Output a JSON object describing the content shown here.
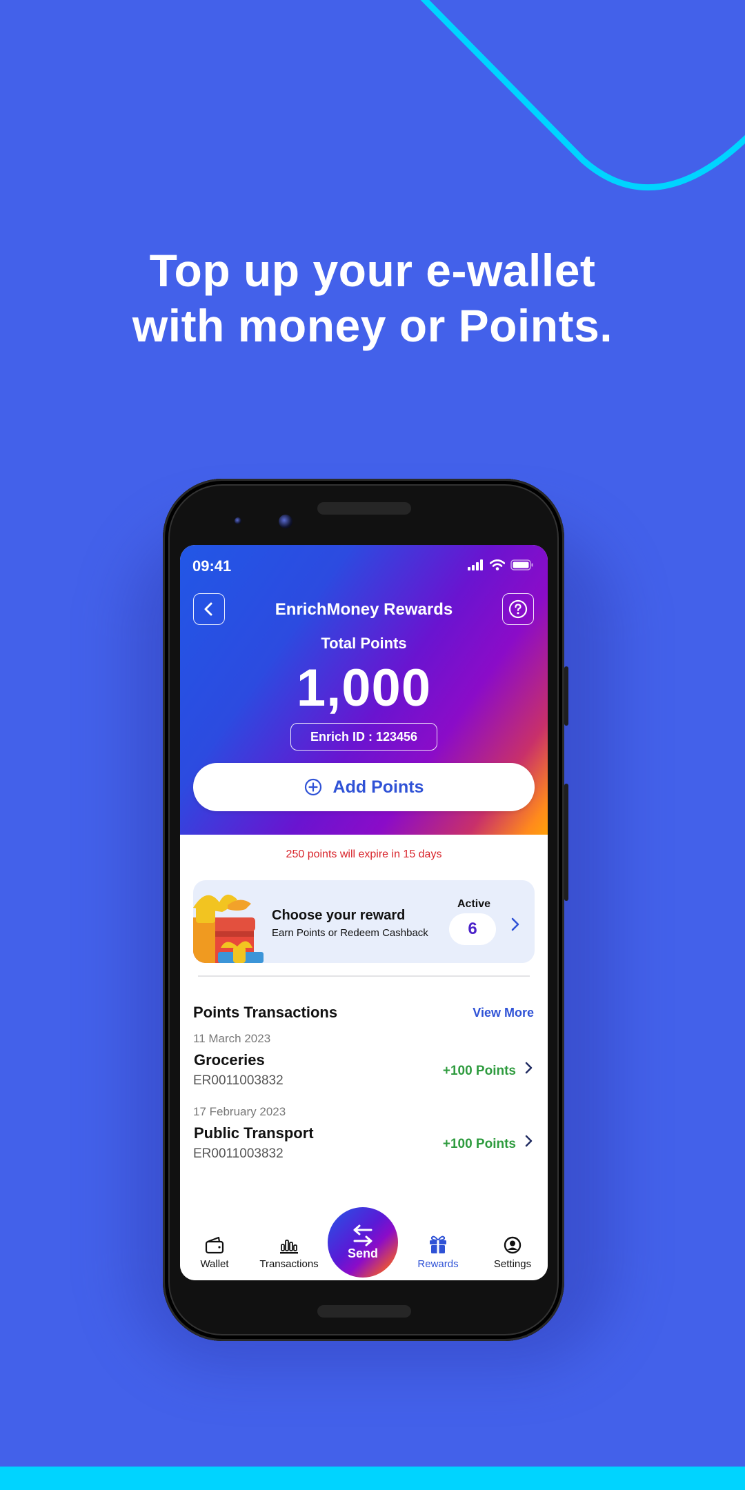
{
  "promo": {
    "headline_line1": "Top up your e-wallet",
    "headline_line2": "with money or Points."
  },
  "colors": {
    "background": "#4361EA",
    "accent_cyan": "#00D4FF",
    "brand_blue": "#2F52D6",
    "expire_red": "#D8232A",
    "points_green": "#2E9B3E"
  },
  "status_bar": {
    "time": "09:41",
    "icons": [
      "signal-icon",
      "wifi-icon",
      "battery-icon"
    ]
  },
  "header": {
    "back_icon": "chevron-left-icon",
    "title": "EnrichMoney Rewards",
    "help_icon": "question-icon"
  },
  "summary": {
    "total_label": "Total Points",
    "total_value": "1,000",
    "enrich_id": "Enrich ID : 123456",
    "add_points_label": "Add Points",
    "add_points_icon": "plus-circle-icon"
  },
  "expire_note": "250 points will expire in 15 days",
  "reward_card": {
    "title": "Choose your reward",
    "subtitle": "Earn Points or Redeem Cashback",
    "active_label": "Active",
    "active_count": "6",
    "icon": "gift-illustration"
  },
  "transactions": {
    "header": "Points Transactions",
    "view_more": "View More",
    "items": [
      {
        "date": "11 March 2023",
        "name": "Groceries",
        "id": "ER0011003832",
        "points": "+100 Points"
      },
      {
        "date": "17 February 2023",
        "name": "Public Transport",
        "id": "ER0011003832",
        "points": "+100 Points"
      }
    ]
  },
  "bottom_nav": {
    "items": [
      {
        "label": "Wallet",
        "icon": "wallet-icon",
        "active": false
      },
      {
        "label": "Transactions",
        "icon": "bar-chart-icon",
        "active": false
      },
      {
        "label": "Send",
        "icon": "swap-arrows-icon",
        "active": false
      },
      {
        "label": "Rewards",
        "icon": "gift-icon",
        "active": true
      },
      {
        "label": "Settings",
        "icon": "user-circle-icon",
        "active": false
      }
    ]
  }
}
